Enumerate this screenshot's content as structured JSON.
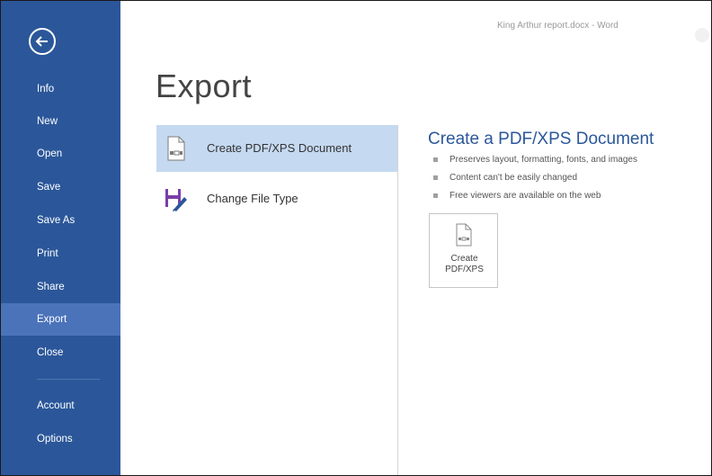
{
  "window": {
    "title": "King Arthur report.docx - Word"
  },
  "sidebar": {
    "items": [
      {
        "label": "Info"
      },
      {
        "label": "New"
      },
      {
        "label": "Open"
      },
      {
        "label": "Save"
      },
      {
        "label": "Save As"
      },
      {
        "label": "Print"
      },
      {
        "label": "Share"
      },
      {
        "label": "Export",
        "active": true
      },
      {
        "label": "Close"
      },
      {
        "label": "Account"
      },
      {
        "label": "Options"
      }
    ]
  },
  "page": {
    "title": "Export"
  },
  "export_options": [
    {
      "label": "Create PDF/XPS Document",
      "selected": true,
      "icon": "pdf-document-icon"
    },
    {
      "label": "Change File Type",
      "selected": false,
      "icon": "change-file-type-icon"
    }
  ],
  "detail": {
    "title": "Create a PDF/XPS Document",
    "bullets": [
      "Preserves layout, formatting, fonts, and images",
      "Content can't be easily changed",
      "Free viewers are available on the web"
    ],
    "button": {
      "line1": "Create",
      "line2": "PDF/XPS"
    }
  },
  "colors": {
    "sidebar": "#2b579a",
    "sidebar_active": "#4b73ba",
    "selected_option": "#c5d9f1",
    "accent_title": "#2b579a"
  }
}
